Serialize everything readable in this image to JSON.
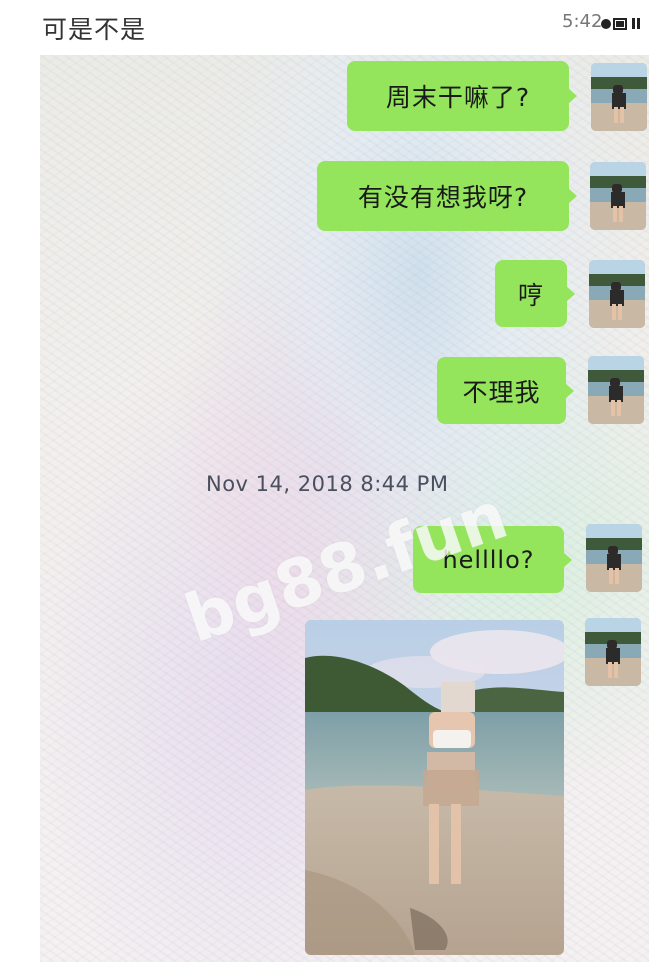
{
  "header": {
    "title": "可是不是",
    "time": "5:42"
  },
  "messages": [
    {
      "text": "周末干嘛了?"
    },
    {
      "text": "有没有想我呀?"
    },
    {
      "text": "哼"
    },
    {
      "text": "不理我"
    },
    {
      "text": "hellllo?"
    }
  ],
  "timestamp": "Nov 14, 2018 8:44 PM",
  "watermark": "bg88.fun",
  "colors": {
    "bubble": "#94e55b",
    "timestamp": "#4a4f5e"
  },
  "icons": {
    "status": "signal-wifi-battery-icon",
    "avatar": "avatar-photo"
  }
}
